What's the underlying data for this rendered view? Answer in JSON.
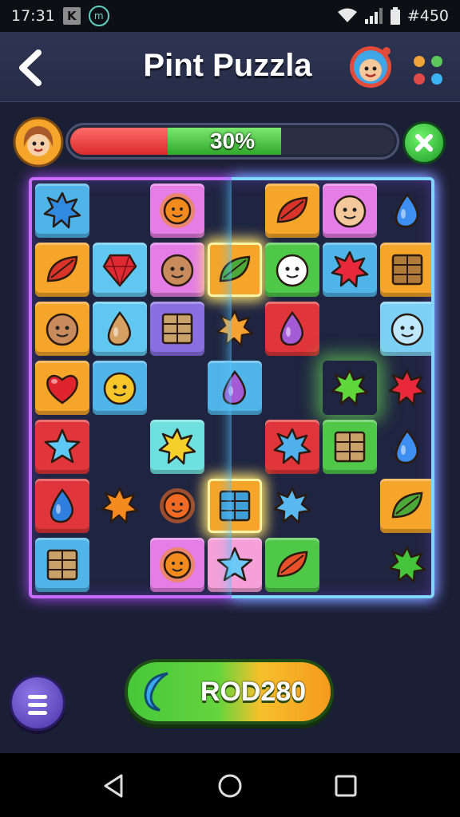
{
  "status_bar": {
    "time": "17:31",
    "app_letter": "K",
    "app_m": "m",
    "battery_text": "#450"
  },
  "header": {
    "title": "Pint Puzzla",
    "back_icon": "chevron-left-icon",
    "menu_dots_colors": [
      "#f2a33a",
      "#5ac95a",
      "#e24a4a",
      "#3ab3f2"
    ]
  },
  "progress": {
    "percent": 30,
    "label": "30%"
  },
  "action_button": {
    "label": "ROD280"
  },
  "colors": {
    "accent_purple": "#c96bff",
    "accent_blue": "#7fd6ff",
    "green": "#45c83a",
    "orange": "#f59a1f"
  },
  "board": {
    "columns": 7,
    "rows": 7,
    "tiles": [
      {
        "row": 0,
        "col": 0,
        "color": "#4fb4e8",
        "symbol": "blue-spiky-face",
        "shape": "splat",
        "fill": "#2f8ae0"
      },
      {
        "row": 0,
        "col": 2,
        "color": "#e47de6",
        "symbol": "sun-face",
        "shape": "sun",
        "fill": "#f28a1e"
      },
      {
        "row": 0,
        "col": 4,
        "color": "#f5a52a",
        "symbol": "chili-pepper",
        "shape": "leaf",
        "fill": "#d9342a"
      },
      {
        "row": 0,
        "col": 5,
        "color": "#e47de6",
        "symbol": "smiling-face",
        "shape": "face",
        "fill": "#f3c99c"
      },
      {
        "row": 0,
        "col": 6,
        "color": "none",
        "symbol": "blue-drop",
        "shape": "drop",
        "fill": "#3c8ff0"
      },
      {
        "row": 1,
        "col": 0,
        "color": "#f5a52a",
        "symbol": "chili-pepper",
        "shape": "leaf",
        "fill": "#d9342a"
      },
      {
        "row": 1,
        "col": 1,
        "color": "#60c8f0",
        "symbol": "red-gem",
        "shape": "gem",
        "fill": "#e02a33"
      },
      {
        "row": 1,
        "col": 2,
        "color": "#e47de6",
        "symbol": "bald-face",
        "shape": "face",
        "fill": "#c98a5c"
      },
      {
        "row": 1,
        "col": 3,
        "color": "#f5a52a",
        "symbol": "leaf-box",
        "shape": "leaf",
        "fill": "#4da83a",
        "glow": true
      },
      {
        "row": 1,
        "col": 4,
        "color": "#4fc84a",
        "symbol": "ghost-creature",
        "shape": "face",
        "fill": "#ffffff"
      },
      {
        "row": 1,
        "col": 5,
        "color": "#4fb4e8",
        "symbol": "red-flower",
        "shape": "splat",
        "fill": "#e8293c"
      },
      {
        "row": 1,
        "col": 6,
        "color": "#f5a52a",
        "symbol": "wooden-crate",
        "shape": "crate",
        "fill": "#b07a3a"
      },
      {
        "row": 2,
        "col": 0,
        "color": "#f5a52a",
        "symbol": "bald-face",
        "shape": "face",
        "fill": "#c98a5c"
      },
      {
        "row": 2,
        "col": 1,
        "color": "#60c8f0",
        "symbol": "squid",
        "shape": "drop",
        "fill": "#d7a063"
      },
      {
        "row": 2,
        "col": 2,
        "color": "#8a6fe0",
        "symbol": "wooden-door",
        "shape": "crate",
        "fill": "#c9a26a"
      },
      {
        "row": 2,
        "col": 3,
        "color": "none",
        "symbol": "orange-star-burst",
        "shape": "splat",
        "fill": "#f5a232"
      },
      {
        "row": 2,
        "col": 4,
        "color": "#e0353a",
        "symbol": "purple-balloon",
        "shape": "drop",
        "fill": "#a65bd6"
      },
      {
        "row": 2,
        "col": 6,
        "color": "#7dd0f5",
        "symbol": "cloud-face",
        "shape": "face",
        "fill": "#bfe8ff"
      },
      {
        "row": 3,
        "col": 0,
        "color": "#f5a52a",
        "symbol": "red-heart",
        "shape": "heart",
        "fill": "#e0242e"
      },
      {
        "row": 3,
        "col": 1,
        "color": "#4fb4e8",
        "symbol": "yellow-robot",
        "shape": "face",
        "fill": "#f5c52a"
      },
      {
        "row": 3,
        "col": 3,
        "color": "#4fb4e8",
        "symbol": "purple-balloon",
        "shape": "drop",
        "fill": "#a65bd6"
      },
      {
        "row": 3,
        "col": 5,
        "color": "none",
        "symbol": "green-glow-star",
        "shape": "splat",
        "fill": "#5ed63c",
        "glow": true
      },
      {
        "row": 3,
        "col": 6,
        "color": "none",
        "symbol": "red-splat",
        "shape": "splat",
        "fill": "#e8293c"
      },
      {
        "row": 4,
        "col": 0,
        "color": "#e0353a",
        "symbol": "blue-star",
        "shape": "star",
        "fill": "#5ec8f5"
      },
      {
        "row": 4,
        "col": 2,
        "color": "#6ee0e0",
        "symbol": "yellow-blob",
        "shape": "splat",
        "fill": "#f5d02a"
      },
      {
        "row": 4,
        "col": 4,
        "color": "#e0353a",
        "symbol": "blue-splat",
        "shape": "splat",
        "fill": "#4fb0ec"
      },
      {
        "row": 4,
        "col": 5,
        "color": "#4fc84a",
        "symbol": "wooden-door",
        "shape": "crate",
        "fill": "#c9a26a"
      },
      {
        "row": 4,
        "col": 6,
        "color": "none",
        "symbol": "blue-rocket",
        "shape": "drop",
        "fill": "#3c8ff0"
      },
      {
        "row": 5,
        "col": 0,
        "color": "#e0353a",
        "symbol": "blue-drop",
        "shape": "drop",
        "fill": "#2f7fe0"
      },
      {
        "row": 5,
        "col": 1,
        "color": "none",
        "symbol": "orange-splat",
        "shape": "splat",
        "fill": "#f58a1e"
      },
      {
        "row": 5,
        "col": 2,
        "color": "none",
        "symbol": "orange-flower",
        "shape": "sun",
        "fill": "#f06a24"
      },
      {
        "row": 5,
        "col": 3,
        "color": "#f5a52a",
        "symbol": "book-crate",
        "shape": "crate",
        "fill": "#3fa0d8",
        "glow": true
      },
      {
        "row": 5,
        "col": 4,
        "color": "none",
        "symbol": "blue-flower",
        "shape": "splat",
        "fill": "#5ab8f0"
      },
      {
        "row": 5,
        "col": 6,
        "color": "#f5a52a",
        "symbol": "leaf-box",
        "shape": "leaf",
        "fill": "#4da83a"
      },
      {
        "row": 6,
        "col": 0,
        "color": "#4fb4e8",
        "symbol": "wooden-door",
        "shape": "crate",
        "fill": "#c9a26a"
      },
      {
        "row": 6,
        "col": 2,
        "color": "#e47de6",
        "symbol": "sun-face",
        "shape": "sun",
        "fill": "#f28a1e"
      },
      {
        "row": 6,
        "col": 3,
        "color": "#f5a0d8",
        "symbol": "blue-star-blob",
        "shape": "star",
        "fill": "#6ec8f5"
      },
      {
        "row": 6,
        "col": 4,
        "color": "#4fc84a",
        "symbol": "red-feather",
        "shape": "leaf",
        "fill": "#e8502a"
      },
      {
        "row": 6,
        "col": 6,
        "color": "none",
        "symbol": "green-splat",
        "shape": "splat",
        "fill": "#43c43a"
      }
    ]
  }
}
